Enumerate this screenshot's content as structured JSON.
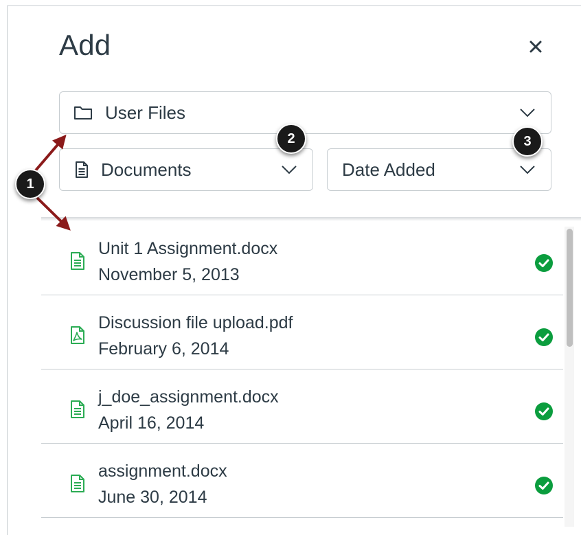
{
  "dialog": {
    "title": "Add",
    "close_icon": "close-icon"
  },
  "filters": {
    "source": {
      "label": "User Files",
      "icon": "folder-icon"
    },
    "type": {
      "label": "Documents",
      "icon": "document-icon"
    },
    "sort": {
      "label": "Date Added"
    }
  },
  "files": [
    {
      "name": "Unit 1 Assignment.docx",
      "date": "November 5, 2013",
      "icon": "document-icon",
      "status": "check-icon"
    },
    {
      "name": "Discussion file upload.pdf",
      "date": "February 6, 2014",
      "icon": "pdf-icon",
      "status": "check-icon"
    },
    {
      "name": "j_doe_assignment.docx",
      "date": "April 16, 2014",
      "icon": "document-icon",
      "status": "check-icon"
    },
    {
      "name": "assignment.docx",
      "date": "June 30, 2014",
      "icon": "document-icon",
      "status": "check-icon"
    }
  ],
  "callouts": [
    "1",
    "2",
    "3"
  ],
  "colors": {
    "file_icon": "#2bac54",
    "check": "#0b9d3e",
    "arrow": "#8b1a1a",
    "border": "#c7cdd1",
    "text": "#2d3b45"
  }
}
